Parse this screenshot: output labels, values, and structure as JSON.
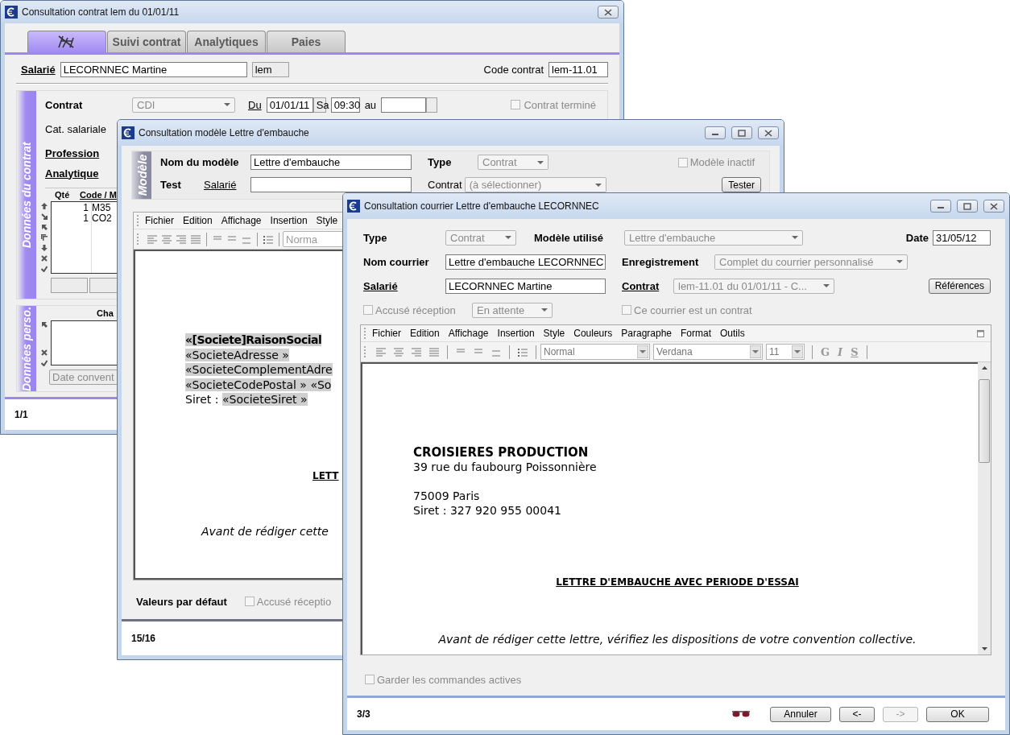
{
  "contract_window": {
    "title": "Consultation contrat lem du 01/01/11",
    "tabs": [
      {
        "kind": "icon",
        "selected": true
      },
      {
        "kind": "text",
        "label": "Suivi contrat",
        "selected": false
      },
      {
        "kind": "text",
        "label": "Analytiques",
        "selected": false
      },
      {
        "kind": "text",
        "label": "Paies",
        "selected": false
      }
    ],
    "employee": {
      "label": "Salarié",
      "value": "LECORNNEC Martine",
      "code": "lem"
    },
    "contract_code": {
      "label": "Code contrat",
      "value": "lem-11.01"
    },
    "section_title": "Données du contrat",
    "contract": {
      "label": "Contrat",
      "value": "CDI"
    },
    "start": {
      "label": "Du",
      "date": "01/01/11",
      "day": "Sa",
      "time": "09:30"
    },
    "end_label": "au",
    "finished": {
      "label": "Contrat terminé",
      "checked": false
    },
    "fields": [
      {
        "kind": "plain",
        "label": "Cat. salariale"
      },
      {
        "kind": "link",
        "label": "Profession"
      },
      {
        "kind": "link",
        "label": "Analytique"
      }
    ],
    "table": {
      "columns": [
        "Qté",
        "Code / M"
      ],
      "rows": [
        {
          "qty": "1",
          "code": "M35"
        },
        {
          "qty": "1",
          "code": "CO2"
        }
      ]
    },
    "perso": {
      "section_title": "Données perso.",
      "column": "Cha",
      "date_placeholder": "Date convent"
    },
    "status": "1/1"
  },
  "model_window": {
    "title": "Consultation modèle Lettre d'embauche",
    "section_title": "Modèle",
    "name": {
      "label": "Nom du modèle",
      "value": "Lettre d'embauche"
    },
    "type": {
      "label": "Type",
      "value": "Contrat"
    },
    "inactive": {
      "label": "Modèle inactif",
      "checked": false
    },
    "test": {
      "label": "Test",
      "employee_label": "Salarié",
      "contract_label": "Contrat",
      "contract_value": "(à sélectionner)",
      "button": "Tester"
    },
    "editor": {
      "menu": [
        "Fichier",
        "Edition",
        "Affichage",
        "Insertion",
        "Style"
      ],
      "style": "Norma"
    },
    "document": [
      {
        "kind": "field",
        "bold": true,
        "segments": [
          {
            "text": "«[Societe]RaisonSocial",
            "field": true
          }
        ]
      },
      {
        "kind": "field",
        "bold": false,
        "segments": [
          {
            "text": "«SocieteAdresse »",
            "field": true
          }
        ]
      },
      {
        "kind": "field",
        "bold": false,
        "segments": [
          {
            "text": "«SocieteComplementAdre",
            "field": true
          }
        ]
      },
      {
        "kind": "field",
        "bold": false,
        "segments": [
          {
            "text": "«SocieteCodePostal » «So",
            "field": true
          }
        ]
      },
      {
        "kind": "field",
        "bold": false,
        "segments": [
          {
            "text": "Siret : ",
            "field": false
          },
          {
            "text": "«SocieteSiret »",
            "field": true
          }
        ]
      },
      {
        "kind": "title",
        "bold": true,
        "segments": [
          {
            "text": "LETT",
            "field": false
          }
        ]
      },
      {
        "kind": "note",
        "bold": false,
        "segments": [
          {
            "text": "Avant de rédiger cette",
            "field": false
          }
        ]
      }
    ],
    "defaults": {
      "label": "Valeurs par défaut",
      "ack": {
        "label": "Accusé réceptio",
        "checked": false
      }
    },
    "status": "15/16"
  },
  "letter_window": {
    "title": "Consultation courrier Lettre d'embauche LECORNNEC",
    "type": {
      "label": "Type",
      "value": "Contrat"
    },
    "model": {
      "label": "Modèle utilisé",
      "value": "Lettre d'embauche"
    },
    "date": {
      "label": "Date",
      "value": "31/05/12"
    },
    "name": {
      "label": "Nom courrier",
      "value": "Lettre d'embauche LECORNNEC"
    },
    "saving": {
      "label": "Enregistrement",
      "value": "Complet du courrier personnalisé"
    },
    "employee": {
      "label": "Salarié",
      "value": "LECORNNEC Martine"
    },
    "contract": {
      "label": "Contrat",
      "value": "lem-11.01 du 01/01/11 - C..."
    },
    "references_button": "Références",
    "ack": {
      "label": "Accusé réception",
      "checked": false,
      "status": "En attente"
    },
    "is_contract": {
      "label": "Ce courrier est un contrat",
      "checked": false
    },
    "editor": {
      "menu": [
        "Fichier",
        "Edition",
        "Affichage",
        "Insertion",
        "Style",
        "Couleurs",
        "Paragraphe",
        "Format",
        "Outils"
      ],
      "style": "Normal",
      "font": "Verdana",
      "size": "11",
      "format_buttons": [
        {
          "kind": "bold",
          "label": "G"
        },
        {
          "kind": "italic",
          "label": "I"
        },
        {
          "kind": "underline",
          "label": "S"
        }
      ]
    },
    "document": [
      {
        "kind": "address",
        "lines": [
          {
            "text": "CROISIERES PRODUCTION",
            "bold": true
          },
          {
            "text": "39 rue du faubourg Poissonnière",
            "bold": false
          }
        ]
      },
      {
        "kind": "address",
        "lines": [
          {
            "text": "75009 Paris",
            "bold": false
          },
          {
            "text": "Siret : 327 920 955 00041",
            "bold": false
          }
        ]
      },
      {
        "kind": "title",
        "lines": [
          {
            "text": "LETTRE D'EMBAUCHE AVEC PERIODE D'ESSAI",
            "bold": true
          }
        ]
      },
      {
        "kind": "note",
        "lines": [
          {
            "text": "Avant de rédiger cette lettre, vérifiez les dispositions de votre convention collective.",
            "bold": false
          }
        ]
      }
    ],
    "keep_commands": {
      "label": "Garder les commandes actives",
      "checked": false
    },
    "status": "3/3",
    "buttons": [
      {
        "label": "Annuler",
        "disabled": false
      },
      {
        "label": "<-",
        "disabled": false
      },
      {
        "label": "->",
        "disabled": true
      },
      {
        "label": "OK",
        "disabled": false
      }
    ]
  }
}
